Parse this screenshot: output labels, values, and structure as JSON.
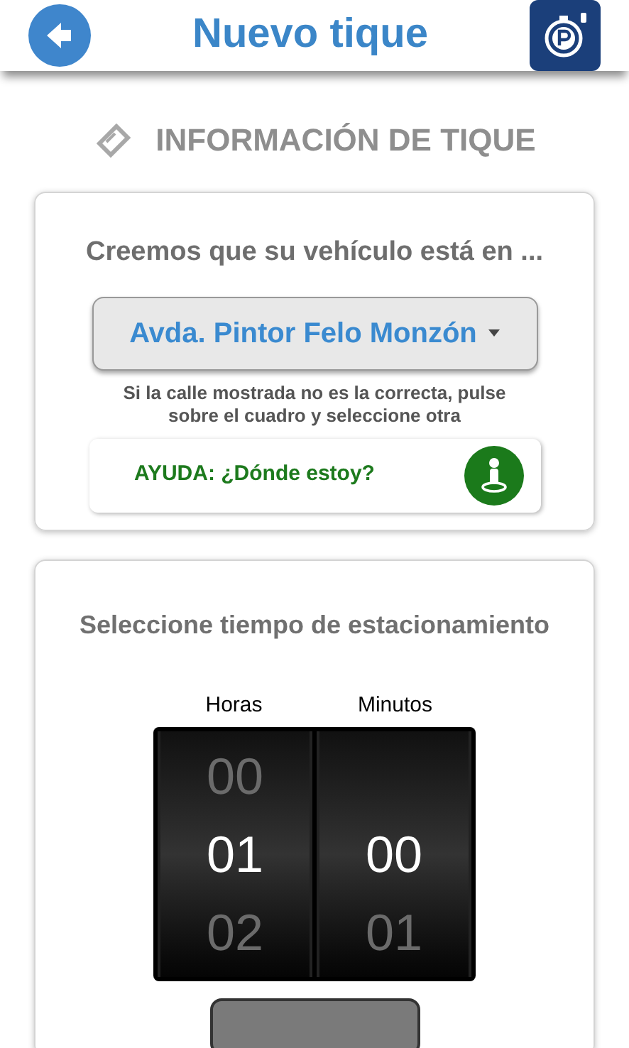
{
  "header": {
    "title": "Nuevo tique"
  },
  "section": {
    "title": "INFORMACIÓN DE TIQUE"
  },
  "location_card": {
    "heading": "Creemos que su vehículo está en ...",
    "street": "Avda. Pintor Felo Monzón",
    "hint": "Si la calle mostrada no es la correcta, pulse sobre el cuadro y seleccione otra",
    "help": "AYUDA: ¿Dónde estoy?"
  },
  "time_card": {
    "heading": "Seleccione tiempo de estacionamiento",
    "columns": [
      {
        "label": "Horas",
        "items": [
          {
            "value": "00",
            "selected": false
          },
          {
            "value": "01",
            "selected": true
          },
          {
            "value": "02",
            "selected": false
          }
        ]
      },
      {
        "label": "Minutos",
        "items": [
          {
            "value": "00",
            "selected": true
          },
          {
            "value": "01",
            "selected": false
          }
        ]
      }
    ]
  }
}
